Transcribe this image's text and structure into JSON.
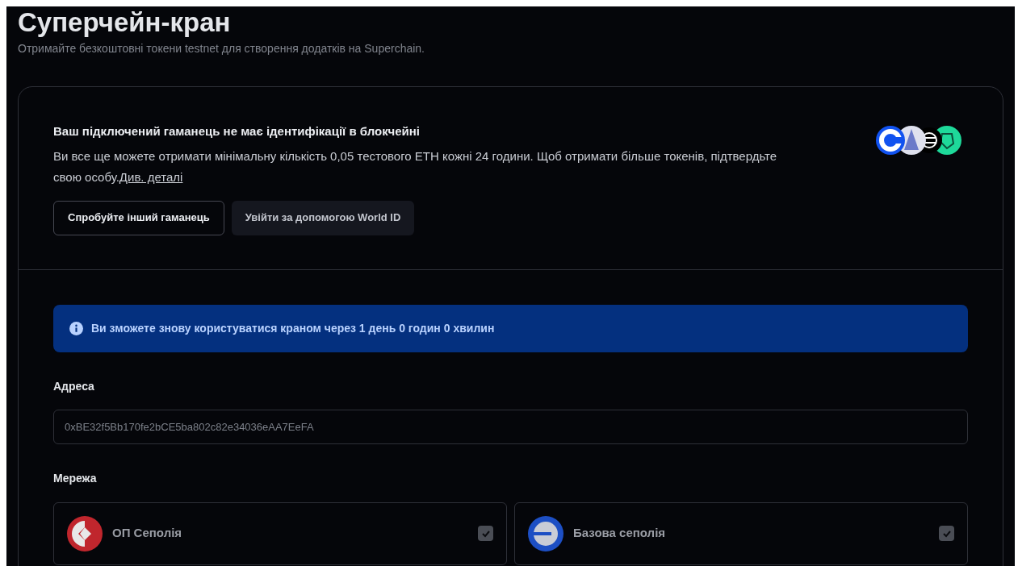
{
  "header": {
    "title": "Суперчейн-кран",
    "subtitle": "Отримайте безкоштовні токени testnet для створення додатків на Superchain."
  },
  "identity": {
    "title": "Ваш підключений гаманець не має ідентифікації в блокчейні",
    "text": "Ви все ще можете отримати мінімальну кількість 0,05 тестового ETH кожні 24 години. Щоб отримати більше токенів, підтвердьте свою особу.",
    "link": "Див. деталі",
    "buttons": [
      {
        "label": "Спробуйте інший гаманець",
        "kind": "outline"
      },
      {
        "label": "Увійти за допомогою World ID",
        "kind": "filled"
      }
    ]
  },
  "alert": {
    "text": "Ви зможете знову користуватися краном через 1 день 0 годин 0 хвилин"
  },
  "address": {
    "label": "Адреса",
    "value": "0xBE32f5Bb170fe2bCE5ba802c82e34036eAA7EeFA"
  },
  "network": {
    "label": "Мережа",
    "options": [
      {
        "name": "ОП Сеполія",
        "kind": "op",
        "checked": true
      },
      {
        "name": "Базова сеполія",
        "kind": "base",
        "checked": true
      }
    ]
  }
}
